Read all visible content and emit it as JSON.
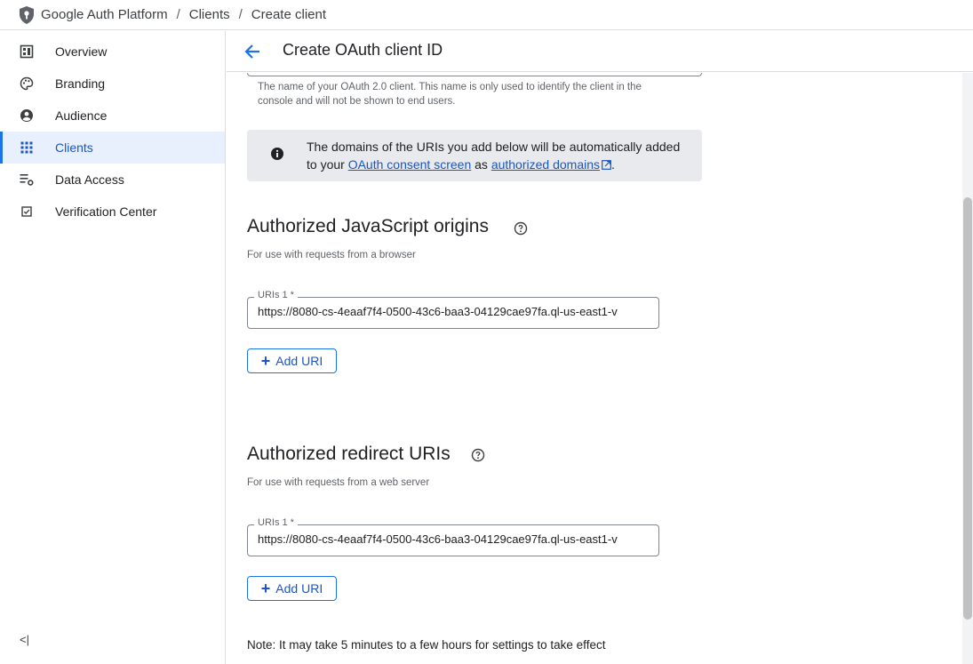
{
  "breadcrumb": {
    "items": [
      "Google Auth Platform",
      "Clients",
      "Create client"
    ],
    "separator": "/"
  },
  "sidebar": {
    "items": [
      {
        "label": "Overview",
        "icon": "dashboard-icon",
        "active": false
      },
      {
        "label": "Branding",
        "icon": "palette-icon",
        "active": false
      },
      {
        "label": "Audience",
        "icon": "account-circle-icon",
        "active": false
      },
      {
        "label": "Clients",
        "icon": "apps-grid-icon",
        "active": true
      },
      {
        "label": "Data Access",
        "icon": "list-settings-icon",
        "active": false
      },
      {
        "label": "Verification Center",
        "icon": "checkbox-icon",
        "active": false
      }
    ],
    "collapse_label": "<|"
  },
  "header": {
    "title": "Create OAuth client ID"
  },
  "name_hint": "The name of your OAuth 2.0 client. This name is only used to identify the client in the console and will not be shown to end users.",
  "info": {
    "text_before": "The domains of the URIs you add below will be automatically added to your ",
    "link1": "OAuth consent screen",
    "text_mid": " as ",
    "link2": "authorized domains",
    "text_after": "."
  },
  "js_origins": {
    "title": "Authorized JavaScript origins",
    "subtitle": "For use with requests from a browser",
    "field_label": "URIs 1 *",
    "value": "https://8080-cs-4eaaf7f4-0500-43c6-baa3-04129cae97fa.ql-us-east1-v",
    "add_label": "Add URI"
  },
  "redirect_uris": {
    "title": "Authorized redirect URIs",
    "subtitle": "For use with requests from a web server",
    "field_label": "URIs 1 *",
    "value": "https://8080-cs-4eaaf7f4-0500-43c6-baa3-04129cae97fa.ql-us-east1-v",
    "add_label": "Add URI"
  },
  "note": "Note: It may take 5 minutes to a few hours for settings to take effect",
  "colors": {
    "accent": "#1a73e8",
    "active_bg": "#e8f0fe",
    "info_bg": "#e8eaed"
  }
}
